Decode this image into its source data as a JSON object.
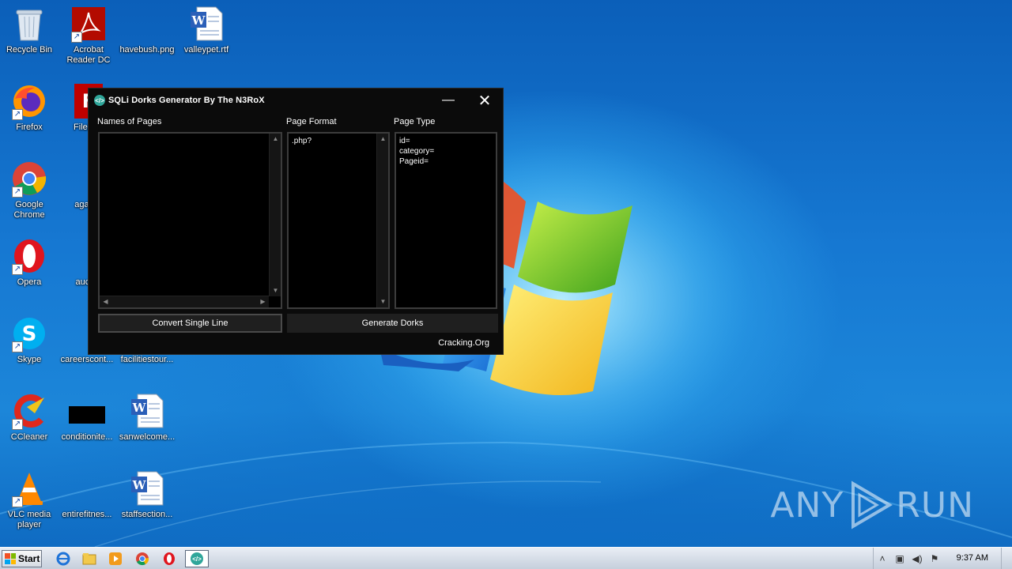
{
  "desktop_icons": [
    {
      "name": "recycle-bin",
      "label": "Recycle Bin"
    },
    {
      "name": "acrobat",
      "label": "Acrobat Reader DC"
    },
    {
      "name": "havebush",
      "label": "havebush.png"
    },
    {
      "name": "valleypet",
      "label": "valleypet.rtf"
    },
    {
      "name": "firefox",
      "label": "Firefox"
    },
    {
      "name": "filezilla",
      "label": "FileZilla"
    },
    {
      "name": "chrome",
      "label": "Google Chrome"
    },
    {
      "name": "against",
      "label": "against"
    },
    {
      "name": "opera",
      "label": "Opera"
    },
    {
      "name": "aucom",
      "label": "aucom"
    },
    {
      "name": "skype",
      "label": "Skype"
    },
    {
      "name": "careerscont",
      "label": "careerscont..."
    },
    {
      "name": "facilitiestour",
      "label": "facilitiestour..."
    },
    {
      "name": "ccleaner",
      "label": "CCleaner"
    },
    {
      "name": "conditionite",
      "label": "conditionite..."
    },
    {
      "name": "sanwelcome",
      "label": "sanwelcome..."
    },
    {
      "name": "vlc",
      "label": "VLC media player"
    },
    {
      "name": "entirefitnes",
      "label": "entirefitnes..."
    },
    {
      "name": "staffsection",
      "label": "staffsection..."
    }
  ],
  "app": {
    "title": "SQLi Dorks Generator By The N3RoX",
    "minimize": "—",
    "close": "✕",
    "labels": {
      "names_of_pages": "Names of Pages",
      "page_format": "Page Format",
      "page_type": "Page Type"
    },
    "names_of_pages": "",
    "page_format": ".php?",
    "page_type": [
      "id=",
      "category=",
      "Pageid="
    ],
    "buttons": {
      "convert": "Convert Single Line",
      "generate": "Generate Dorks"
    },
    "footer_link": "Cracking.Org"
  },
  "watermark": {
    "left": "ANY",
    "right": "RUN"
  },
  "taskbar": {
    "start_label": "Start",
    "clock": "9:37 AM"
  },
  "colors": {
    "app_bg": "#0b0b0b",
    "desktop_blue": "#1678d2",
    "app_icon": "#2fa69a"
  }
}
